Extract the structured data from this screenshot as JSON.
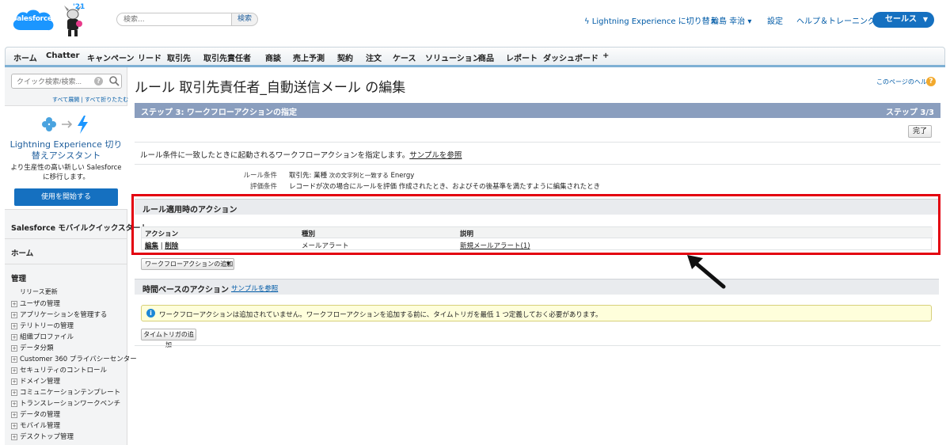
{
  "header": {
    "logo_text": "salesforce",
    "mascot_year": "'21",
    "search_placeholder": "検索...",
    "search_button": "検索",
    "lightning_switch": "Lightning Experience に切り替え",
    "user_name": "輪島 幸治",
    "setup": "設定",
    "help_training": "ヘルプ＆トレーニング",
    "app_name": "セールス"
  },
  "tabs": [
    "ホーム",
    "Chatter",
    "キャンペーン",
    "リード",
    "取引先",
    "取引先責任者",
    "商談",
    "売上予測",
    "契約",
    "注文",
    "ケース",
    "ソリューション",
    "商品",
    "レポート",
    "ダッシュボード",
    "+"
  ],
  "sidebar": {
    "quick_search_placeholder": "クイック検索/検索...",
    "expand_all": "すべて展開",
    "collapse_all": "すべて折りたたむ",
    "promo_title": "Lightning Experience 切り替えアシスタント",
    "promo_desc": "より生産性の高い新しい Salesforce に移行します。",
    "promo_button": "使用を開始する",
    "mobile_quickstart": "Salesforce モバイルクイックスタート",
    "home": "ホーム",
    "admin": "管理",
    "release_updates": "リリース更新",
    "items": [
      "ユーザの管理",
      "アプリケーションを管理する",
      "テリトリーの管理",
      "組織プロファイル",
      "データ分類",
      "Customer 360 プライバシーセンター",
      "セキュリティのコントロール",
      "ドメイン管理",
      "コミュニケーションテンプレート",
      "トランスレーションワークベンチ",
      "データの管理",
      "モバイル管理",
      "デスクトップ管理"
    ]
  },
  "main": {
    "title": "ルール 取引先責任者_自動送信メール の編集",
    "page_help": "このページのヘルプ",
    "step_title": "ステップ 3: ワークフローアクションの指定",
    "step_count": "ステップ 3/3",
    "done_button": "完了",
    "description": "ルール条件に一致したときに起動されるワークフローアクションを指定します。",
    "sample_link": "サンプルを参照",
    "criteria": {
      "rule_label": "ルール条件",
      "rule_value_a": "取引先: 業種",
      "rule_value_op": "次の文字列と一致する",
      "rule_value_b": "Energy",
      "eval_label": "評価条件",
      "eval_value": "レコードが次の場合にルールを評価 作成されたとき、およびその後基準を満たすように編集されたとき"
    },
    "immediate_section": "ルール適用時のアクション",
    "table": {
      "headers": [
        "アクション",
        "種別",
        "説明"
      ],
      "row": {
        "edit": "編集",
        "sep": "|",
        "delete": "削除",
        "type": "メールアラート",
        "description": "新規メールアラート(1)"
      }
    },
    "add_action_button": "ワークフローアクションの追加",
    "time_section": "時間ベースのアクション",
    "time_sample_link": "サンプルを参照",
    "info_message": "ワークフローアクションは追加されていません。ワークフローアクションを追加する前に、タイムトリガを最低 1 つ定義しておく必要があります。",
    "add_trigger_button": "タイムトリガの追加"
  },
  "colors": {
    "brand_blue": "#1570c0",
    "step_bar": "#8a9ebe",
    "highlight_red": "#e3000f"
  }
}
